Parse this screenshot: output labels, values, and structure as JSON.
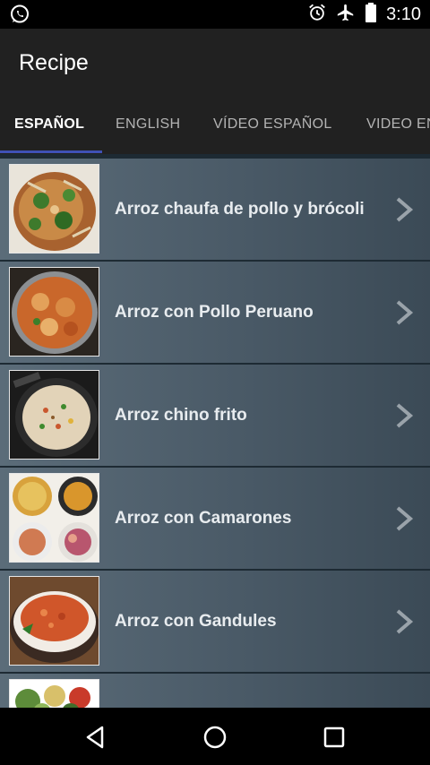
{
  "status_bar": {
    "time": "3:10"
  },
  "app": {
    "title": "Recipe"
  },
  "tabs": [
    {
      "label": "ESPAÑOL",
      "active": true
    },
    {
      "label": "ENGLISH",
      "active": false
    },
    {
      "label": "VÍDEO ESPAÑOL",
      "active": false
    },
    {
      "label": "VIDEO ENGLISH",
      "active": false
    }
  ],
  "recipes": [
    {
      "title": "Arroz chaufa de pollo y brócoli"
    },
    {
      "title": "Arroz con Pollo Peruano"
    },
    {
      "title": "Arroz chino frito"
    },
    {
      "title": "Arroz con Camarones"
    },
    {
      "title": "Arroz con Gandules"
    },
    {
      "title": ""
    }
  ],
  "colors": {
    "accent": "#3f51b5",
    "app_bar": "#212121",
    "list_item": "#4f606d"
  }
}
